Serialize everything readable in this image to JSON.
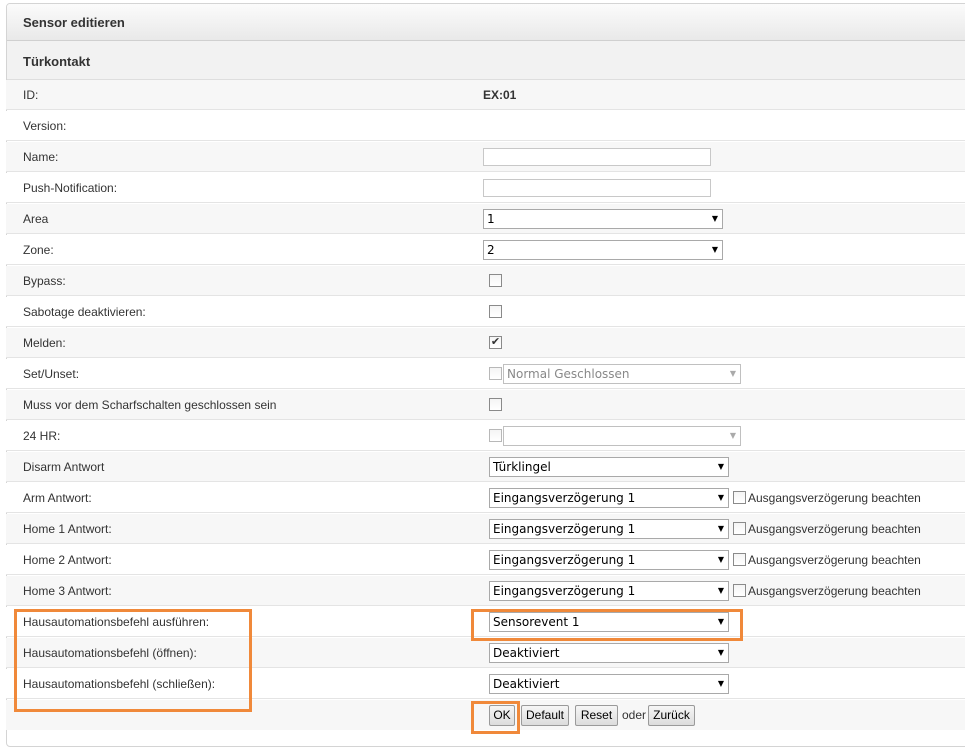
{
  "header": {
    "title": "Sensor editieren"
  },
  "section": {
    "title": "Türkontakt"
  },
  "fields": {
    "id": {
      "label": "ID:",
      "value": "EX:01"
    },
    "version": {
      "label": "Version:"
    },
    "name": {
      "label": "Name:",
      "value": ""
    },
    "push": {
      "label": "Push-Notification:",
      "value": ""
    },
    "area": {
      "label": "Area",
      "value": "1"
    },
    "zone": {
      "label": "Zone:",
      "value": "2"
    },
    "bypass": {
      "label": "Bypass:",
      "checked": false
    },
    "sabotage": {
      "label": "Sabotage deaktivieren:",
      "checked": false
    },
    "melden": {
      "label": "Melden:",
      "checked": true,
      "check_glyph": "✔"
    },
    "setunset": {
      "label": "Set/Unset:",
      "checked": false,
      "value": "Normal Geschlossen"
    },
    "muss": {
      "label": "Muss vor dem Scharfschalten geschlossen sein",
      "checked": false
    },
    "hr24": {
      "label": "24 HR:",
      "checked": false,
      "value": ""
    },
    "disarm": {
      "label": "Disarm Antwort",
      "value": "Türklingel"
    },
    "arm": {
      "label": "Arm Antwort:",
      "value": "Eingangsverzögerung 1",
      "extra": "Ausgangsverzögerung beachten"
    },
    "home1": {
      "label": "Home 1 Antwort:",
      "value": "Eingangsverzögerung 1",
      "extra": "Ausgangsverzögerung beachten"
    },
    "home2": {
      "label": "Home 2 Antwort:",
      "value": "Eingangsverzögerung 1",
      "extra": "Ausgangsverzögerung beachten"
    },
    "home3": {
      "label": "Home 3 Antwort:",
      "value": "Eingangsverzögerung 1",
      "extra": "Ausgangsverzögerung beachten"
    },
    "haus_ausf": {
      "label": "Hausautomationsbefehl ausführen:",
      "value": "Sensorevent 1"
    },
    "haus_oeff": {
      "label": "Hausautomationsbefehl (öffnen):",
      "value": "Deaktiviert"
    },
    "haus_schl": {
      "label": "Hausautomationsbefehl (schließen):",
      "value": "Deaktiviert"
    }
  },
  "buttons": {
    "ok": "OK",
    "default": "Default",
    "reset": "Reset",
    "or": "oder",
    "back": "Zurück"
  },
  "icons": {
    "dropdown_arrow": "▼"
  },
  "colors": {
    "highlight": "#f0893a"
  }
}
